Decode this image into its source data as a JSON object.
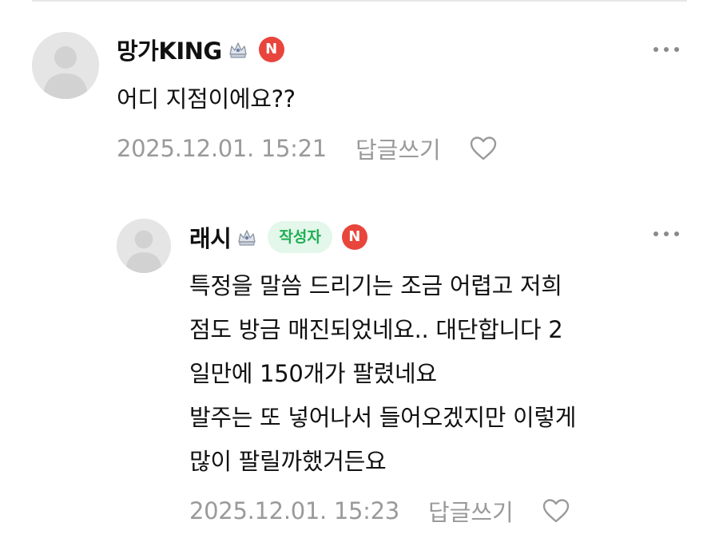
{
  "comments": [
    {
      "nickname": "망가KING",
      "badge_n": "N",
      "text": "어디 지점이에요??",
      "date": "2025.12.01. 15:21",
      "reply_label": "답글쓰기"
    },
    {
      "nickname": "래시",
      "author_badge": "작성자",
      "badge_n": "N",
      "text": "특정을 말씀 드리기는 조금 어렵고 저희\n점도 방금 매진되었네요.. 대단합니다 2\n일만에 150개가 팔렸네요\n발주는 또 넣어나서 들어오겠지만 이렇게\n많이 팔릴까했거든요",
      "date": "2025.12.01. 15:23",
      "reply_label": "답글쓰기"
    }
  ],
  "colors": {
    "n_badge": "#e8453c",
    "author_badge_bg": "#e3f7ea",
    "author_badge_text": "#1fae54",
    "meta_text": "#9a9a9a"
  },
  "icons": [
    "avatar-placeholder",
    "crown-icon",
    "more-icon",
    "heart-icon"
  ]
}
